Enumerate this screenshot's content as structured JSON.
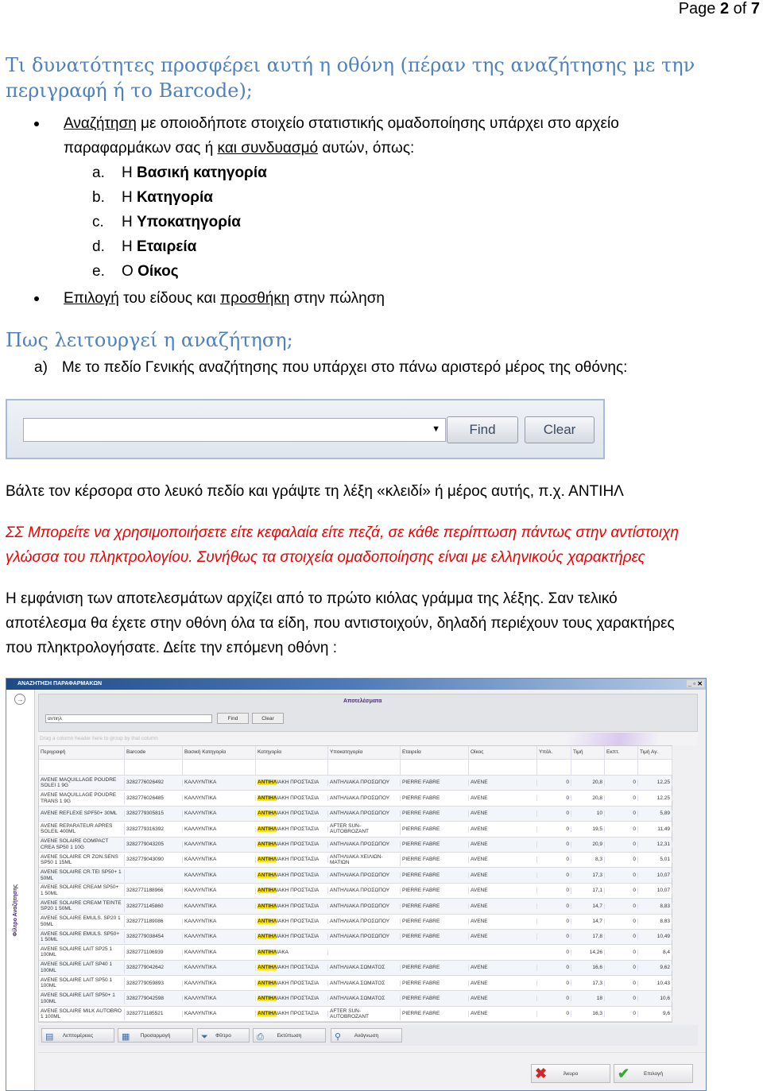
{
  "page": {
    "prefix": "Page ",
    "current": "2",
    "of": " of ",
    "total": "7"
  },
  "h1": {
    "line1": "Τι δυνατότητες προσφέρει αυτή η οθόνη (πέραν της αναζήτησης με την",
    "line2": "περιγραφή ή το Barcode);"
  },
  "bullet1": {
    "u1": "Αναζήτηση",
    "t1": "  με οποιοδήποτε στοιχείο στατιστικής ομαδοποίησης υπάρχει στο αρχείο",
    "t2": "παραφαρμάκων σας ή ",
    "u2": "και συνδυασμό",
    "t3": " αυτών, όπως:"
  },
  "list": [
    {
      "m": "a.",
      "p": "Η ",
      "b": "Βασική κατηγορία"
    },
    {
      "m": "b.",
      "p": "Η ",
      "b": "Κατηγορία"
    },
    {
      "m": "c.",
      "p": "Η ",
      "b": "Υποκατηγορία"
    },
    {
      "m": "d.",
      "p": "Η ",
      "b": "Εταιρεία"
    },
    {
      "m": "e.",
      "p": "Ο ",
      "b": "Οίκος"
    }
  ],
  "bullet2": {
    "u1": "Επιλογή",
    "t1": " του είδους και ",
    "u2": "προσθήκη",
    "t2": " στην πώληση"
  },
  "h2": "Πως λειτουργεί η αναζήτηση;",
  "step_a": {
    "m": "a)",
    "t": "Με το πεδίο Γενικής αναζήτησης που υπάρχει στο πάνω αριστερό μέρος της οθόνης:"
  },
  "searchbox": {
    "find": "Find",
    "clear": "Clear"
  },
  "p1": "Βάλτε τον κέρσορα στο λευκό πεδίο και γράψτε τη λέξη «κλειδί» ή μέρος αυτής, π.χ. ΑΝΤΙΗΛ",
  "red": {
    "l1": "ΣΣ Μπορείτε να χρησιμοποιήσετε είτε κεφαλαία είτε πεζά, σε κάθε περίπτωση πάντως στην αντίστοιχη",
    "l2": "γλώσσα του πληκτρολογίου. Συνήθως τα στοιχεία ομαδοποίησης  είναι με ελληνικούς χαρακτήρες"
  },
  "p2": {
    "l1": "Η εμφάνιση των αποτελεσμάτων αρχίζει από το πρώτο κιόλας γράμμα της λέξης. Σαν τελικό",
    "l2": "αποτέλεσμα θα έχετε στην οθόνη όλα τα είδη, που αντιστοιχούν, δηλαδή περιέχουν τους χαρακτήρες",
    "l3": "που πληκτρολογήσατε. Δείτε την επόμενη οθόνη :"
  },
  "app": {
    "title": "ΑΝΑΖΗΤΗΣΗ ΠΑΡΑΦΑΡΜΑΚΩΝ",
    "side_label": "Φίλτρο Αναζήτησης",
    "panel_title": "Αποτελέσματα",
    "search_value": "αντιηλ",
    "find": "Find",
    "clear": "Clear",
    "drag_hint": "Drag a column header here to group by that column",
    "highlight": "ΑΝΤΙΗΛ",
    "columns": [
      "Περιγραφή",
      "Barcode",
      "Βασική Κατηγορία",
      "Κατηγορία",
      "Υποκατηγορία",
      "Εταιρεία",
      "Οίκος",
      "Υπόλ.",
      "Τιμή",
      "Εκπτ.",
      "Τιμή Αγ."
    ],
    "rows": [
      [
        "AVENE MAQUILLAGE POUDRE SOLEI 1 9G",
        "3282776026492",
        "ΚΑΛΛΥΝΤΙΚΑ",
        "ΑΝΤΙΗΛΙΑΚΗ ΠΡΟΣΤΑΣΙΑ",
        "ΑΝΤΗΛΙΑΚΑ ΠΡΟΣΩΠΟΥ",
        "PIERRE FABRE",
        "AVENE",
        "0",
        "20,8",
        "0",
        "12,25"
      ],
      [
        "AVENE MAQUILLAGE POUDRE TRANS 1 9G",
        "3282776026485",
        "ΚΑΛΛΥΝΤΙΚΑ",
        "ΑΝΤΙΗΛΙΑΚΗ ΠΡΟΣΤΑΣΙΑ",
        "ΑΝΤΗΛΙΑΚΑ ΠΡΟΣΩΠΟΥ",
        "PIERRE FABRE",
        "AVENE",
        "0",
        "20,8",
        "0",
        "12,25"
      ],
      [
        "AVENE REFLEXE SPF50+ 30ML",
        "3282779305815",
        "ΚΑΛΛΥΝΤΙΚΑ",
        "ΑΝΤΙΗΛΙΑΚΗ ΠΡΟΣΤΑΣΙΑ",
        "ΑΝΤΗΛΙΑΚΑ ΠΡΟΣΩΠΟΥ",
        "PIERRE FABRE",
        "AVENE",
        "0",
        "10",
        "0",
        "5,89"
      ],
      [
        "AVENE REPARATEUR APRES SOLEIL 400ML",
        "3282779316392",
        "ΚΑΛΛΥΝΤΙΚΑ",
        "ΑΝΤΙΗΛΙΑΚΗ ΠΡΟΣΤΑΣΙΑ",
        "AFTER SUN-AUTOBROZANT",
        "PIERRE FABRE",
        "AVENE",
        "0",
        "19,5",
        "0",
        "11,49"
      ],
      [
        "AVENE SOLAIRE COMPACT CREA SP50 1 10G",
        "3282779043205",
        "ΚΑΛΛΥΝΤΙΚΑ",
        "ΑΝΤΙΗΛΙΑΚΗ ΠΡΟΣΤΑΣΙΑ",
        "ΑΝΤΗΛΙΑΚΑ ΠΡΟΣΩΠΟΥ",
        "PIERRE FABRE",
        "AVENE",
        "0",
        "20,9",
        "0",
        "12,31"
      ],
      [
        "AVENE SOLAIRE CR ZON.SENS SP50 1 15ML",
        "3282779043090",
        "ΚΑΛΛΥΝΤΙΚΑ",
        "ΑΝΤΙΗΛΙΑΚΗ ΠΡΟΣΤΑΣΙΑ",
        "ΑΝΤΗΛΙΑΚΑ ΧΕΙΛΙΩΝ-ΜΑΤΙΩΝ",
        "PIERRE FABRE",
        "AVENE",
        "0",
        "8,3",
        "0",
        "5,01"
      ],
      [
        "AVENE SOLAIRE CR.TEI SP50+ 1 50ML",
        "",
        "ΚΑΛΛΥΝΤΙΚΑ",
        "ΑΝΤΙΗΛΙΑΚΗ ΠΡΟΣΤΑΣΙΑ",
        "ΑΝΤΗΛΙΑΚΑ ΠΡΟΣΩΠΟΥ",
        "PIERRE FABRE",
        "AVENE",
        "0",
        "17,3",
        "0",
        "10,07"
      ],
      [
        "AVENE SOLAIRE CREAM SP50+ 1 50ML",
        "3282771188966",
        "ΚΑΛΛΥΝΤΙΚΑ",
        "ΑΝΤΙΗΛΙΑΚΗ ΠΡΟΣΤΑΣΙΑ",
        "ΑΝΤΗΛΙΑΚΑ ΠΡΟΣΩΠΟΥ",
        "PIERRE FABRE",
        "AVENE",
        "0",
        "17,1",
        "0",
        "10,07"
      ],
      [
        "AVENE SOLAIRE CREAM TEINTE SP20 1 50ML",
        "3282771145860",
        "ΚΑΛΛΥΝΤΙΚΑ",
        "ΑΝΤΙΗΛΙΑΚΗ ΠΡΟΣΤΑΣΙΑ",
        "ΑΝΤΗΛΙΑΚΑ ΠΡΟΣΩΠΟΥ",
        "PIERRE FABRE",
        "AVENE",
        "0",
        "14,7",
        "0",
        "8,83"
      ],
      [
        "AVENE SOLAIRE EMULS. SP20 1 50ML",
        "3282771189086",
        "ΚΑΛΛΥΝΤΙΚΑ",
        "ΑΝΤΙΗΛΙΑΚΗ ΠΡΟΣΤΑΣΙΑ",
        "ΑΝΤΗΛΙΑΚΑ ΠΡΟΣΩΠΟΥ",
        "PIERRE FABRE",
        "AVENE",
        "0",
        "14,7",
        "0",
        "8,83"
      ],
      [
        "AVENE SOLAIRE EMULS. SP50+ 1 50ML",
        "3282779038454",
        "ΚΑΛΛΥΝΤΙΚΑ",
        "ΑΝΤΙΗΛΙΑΚΗ ΠΡΟΣΤΑΣΙΑ",
        "ΑΝΤΗΛΙΑΚΑ ΠΡΟΣΩΠΟΥ",
        "PIERRE FABRE",
        "AVENE",
        "0",
        "17,8",
        "0",
        "10,49"
      ],
      [
        "AVENE SOLAIRE LAIT SP25 1 100ML",
        "3282771106939",
        "ΚΑΛΛΥΝΤΙΚΑ",
        "ΑΝΤΙΗΛΙΑΚΑ",
        "",
        "",
        "",
        "0",
        "14,26",
        "0",
        "8,4"
      ],
      [
        "AVENE SOLAIRE LAIT SP40 1 100ML",
        "3282779042642",
        "ΚΑΛΛΥΝΤΙΚΑ",
        "ΑΝΤΙΗΛΙΑΚΗ ΠΡΟΣΤΑΣΙΑ",
        "ΑΝΤΗΛΙΑΚΑ ΣΩΜΑΤΟΣ",
        "PIERRE FABRE",
        "AVENE",
        "0",
        "16,6",
        "0",
        "9,62"
      ],
      [
        "AVENE SOLAIRE LAIT SP50 1 100ML",
        "3282779059893",
        "ΚΑΛΛΥΝΤΙΚΑ",
        "ΑΝΤΙΗΛΙΑΚΗ ΠΡΟΣΤΑΣΙΑ",
        "ΑΝΤΗΛΙΑΚΑ ΣΩΜΑΤΟΣ",
        "PIERRE FABRE",
        "AVENE",
        "0",
        "17,3",
        "0",
        "10,43"
      ],
      [
        "AVENE SOLAIRE LAIT SP50+ 1 100ML",
        "3282779042598",
        "ΚΑΛΛΥΝΤΙΚΑ",
        "ΑΝΤΙΗΛΙΑΚΗ ΠΡΟΣΤΑΣΙΑ",
        "ΑΝΤΗΛΙΑΚΑ ΣΩΜΑΤΟΣ",
        "PIERRE FABRE",
        "AVENE",
        "0",
        "18",
        "0",
        "10,6"
      ],
      [
        "AVENE SOLAIRE MILK AUTOBRO 1 100ML",
        "3282771185521",
        "ΚΑΛΛΥΝΤΙΚΑ",
        "ΑΝΤΙΗΛΙΑΚΗ ΠΡΟΣΤΑΣΙΑ",
        "AFTER SUN-AUTOBROZANT",
        "PIERRE FABRE",
        "AVENE",
        "0",
        "16,3",
        "0",
        "9,6"
      ]
    ],
    "toolbar": [
      {
        "label": "Λεπτομέρειες",
        "icon": "details-icon"
      },
      {
        "label": "Προσαρμογή",
        "icon": "customize-icon"
      },
      {
        "label": "Φίλτρο",
        "icon": "filter-icon"
      },
      {
        "label": "Εκτύπωση",
        "icon": "print-icon"
      },
      {
        "label": "Ανάγνωση",
        "icon": "magnifier-icon"
      }
    ],
    "cancel": "Άκυρο",
    "select": "Επιλογή",
    "colors": {
      "title_bar": "#1e4a86",
      "highlight": "#ffe600",
      "accent_text": "#4a2a7a"
    }
  }
}
